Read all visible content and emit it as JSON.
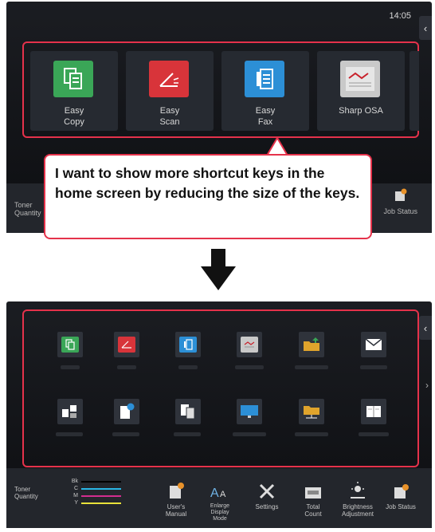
{
  "top": {
    "time": "14:05",
    "side_tab": "‹",
    "keys": [
      {
        "label": "Easy\nCopy",
        "icon": "easy-copy-icon",
        "color": "#3aa657"
      },
      {
        "label": "Easy\nScan",
        "icon": "easy-scan-icon",
        "color": "#d8343a"
      },
      {
        "label": "Easy\nFax",
        "icon": "easy-fax-icon",
        "color": "#2c8fd6"
      },
      {
        "label": "Sharp OSA",
        "icon": "sharp-osa-icon",
        "color": "#c9c9c9"
      }
    ],
    "bar_left": "Toner\nQuantity",
    "bar_right": "Job Status"
  },
  "callout": {
    "text": "I want to show more shortcut keys in the home screen by reducing the size of the keys."
  },
  "bottom": {
    "side_tab": "‹",
    "page_arrow": "›",
    "keys_row1": [
      {
        "icon": "easy-copy-icon",
        "color": "#3aa657"
      },
      {
        "icon": "easy-scan-icon",
        "color": "#d8343a"
      },
      {
        "icon": "easy-fax-icon",
        "color": "#2c8fd6"
      },
      {
        "icon": "sharp-osa-icon",
        "color": "#c9c9c9"
      },
      {
        "icon": "folder-send-icon",
        "color": "#e0a42c"
      },
      {
        "icon": "email-icon",
        "color": "#ffffff"
      }
    ],
    "keys_row2": [
      {
        "icon": "copy-multi-icon",
        "color": "#ffffff"
      },
      {
        "icon": "document-info-icon",
        "color": "#ffffff"
      },
      {
        "icon": "copy-stack-icon",
        "color": "#ffffff"
      },
      {
        "icon": "monitor-icon",
        "color": "#2c8fd6"
      },
      {
        "icon": "network-folder-icon",
        "color": "#e0a42c"
      },
      {
        "icon": "book-icon",
        "color": "#ffffff"
      }
    ],
    "toner_label": "Toner\nQuantity",
    "toner": [
      {
        "name": "Bk",
        "color": "#000000"
      },
      {
        "name": "C",
        "color": "#2ab7e6"
      },
      {
        "name": "M",
        "color": "#d22d8f"
      },
      {
        "name": "Y",
        "color": "#e8e23a"
      }
    ],
    "bar_items": [
      {
        "label": "User's\nManual",
        "icon": "users-manual-icon"
      },
      {
        "label": "Enlarge\nDisplay\nMode",
        "icon": "enlarge-display-icon"
      },
      {
        "label": "Settings",
        "icon": "settings-icon"
      },
      {
        "label": "Total\nCount",
        "icon": "total-count-icon"
      },
      {
        "label": "Brightness\nAdjustment",
        "icon": "brightness-icon"
      },
      {
        "label": "Job Status",
        "icon": "job-status-icon"
      }
    ]
  }
}
